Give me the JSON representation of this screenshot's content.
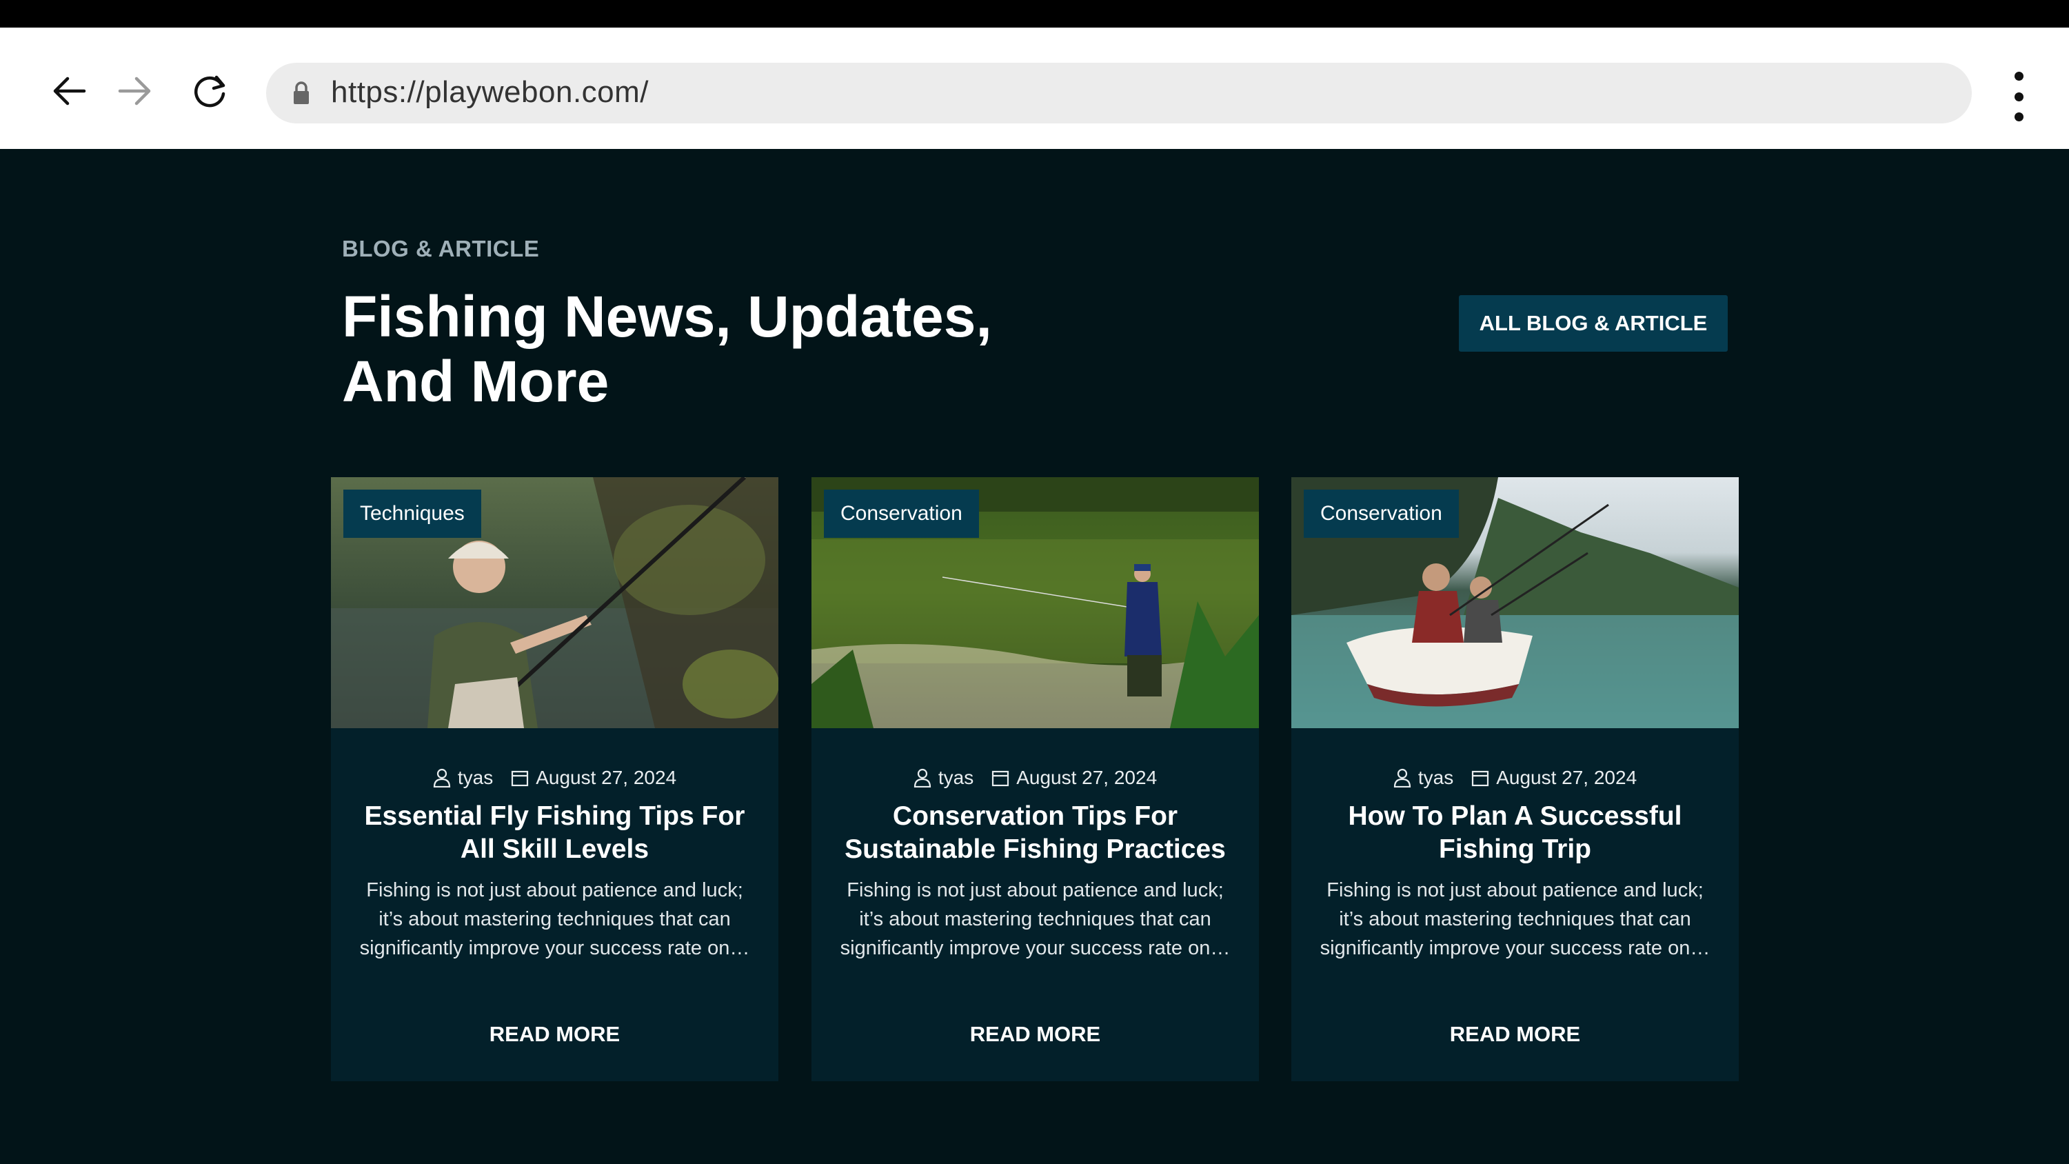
{
  "browser": {
    "url": "https://playwebon.com/"
  },
  "section": {
    "eyebrow": "BLOG & ARTICLE",
    "headline_line1": "Fishing News, Updates,",
    "headline_line2": "And More",
    "all_button": "ALL BLOG & ARTICLE"
  },
  "cards": [
    {
      "category": "Techniques",
      "author": "tyas",
      "date": "August 27, 2024",
      "title_line1": "Essential Fly Fishing Tips For",
      "title_line2": "All Skill Levels",
      "excerpt": "Fishing is not just about patience and luck; it’s about mastering techniques that can significantly improve your success rate on…",
      "read_more": "READ MORE"
    },
    {
      "category": "Conservation",
      "author": "tyas",
      "date": "August 27, 2024",
      "title_line1": "Conservation Tips For",
      "title_line2": "Sustainable Fishing Practices",
      "excerpt": "Fishing is not just about patience and luck; it’s about mastering techniques that can significantly improve your success rate on…",
      "read_more": "READ MORE"
    },
    {
      "category": "Conservation",
      "author": "tyas",
      "date": "August 27, 2024",
      "title_line1": "How To Plan A Successful",
      "title_line2": "Fishing Trip",
      "excerpt": "Fishing is not just about patience and luck; it’s about mastering techniques that can significantly improve your success rate on…",
      "read_more": "READ MORE"
    }
  ],
  "colors": {
    "page_bg": "#021418",
    "card_bg": "#03202a",
    "accent": "#053b4f"
  }
}
